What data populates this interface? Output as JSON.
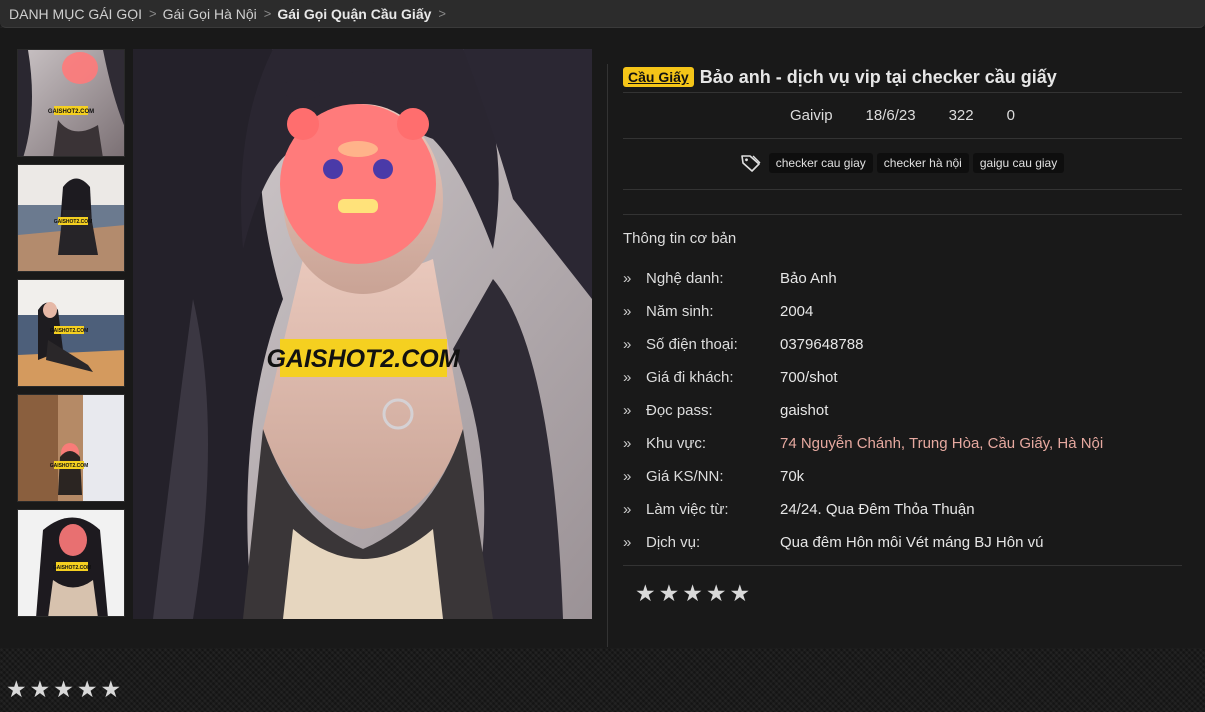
{
  "breadcrumb": {
    "items": [
      {
        "label": "DANH MỤC GÁI GỌI"
      },
      {
        "label": "Gái Gọi Hà Nội"
      },
      {
        "label": "Gái Gọi Quận Cầu Giấy"
      }
    ]
  },
  "watermark": "GAISHOT2.COM",
  "post": {
    "badge": "Cầu Giấy",
    "title": "Bảo anh - dịch vụ vip tại checker cầu giấy",
    "author": "Gaivip",
    "date": "18/6/23",
    "views": "322",
    "comments": "0",
    "tags": [
      "checker cau giay",
      "checker hà nội",
      "gaigu cau giay"
    ]
  },
  "details": {
    "section_title": "Thông tin cơ bản",
    "rows": [
      {
        "label": "Nghệ danh:",
        "value": "Bảo Anh"
      },
      {
        "label": "Năm sinh:",
        "value": "2004"
      },
      {
        "label": "Số điện thoại:",
        "value": "0379648788"
      },
      {
        "label": "Giá đi khách:",
        "value": "700/shot"
      },
      {
        "label": "Đọc pass:",
        "value": "gaishot"
      },
      {
        "label": "Khu vực:",
        "value": "74 Nguyễn Chánh, Trung Hòa, Cầu Giấy, Hà Nội"
      },
      {
        "label": "Giá KS/NN:",
        "value": "70k"
      },
      {
        "label": "Làm việc từ:",
        "value": "24/24. Qua Đêm Thỏa Thuận"
      },
      {
        "label": "Dịch vụ:",
        "value": "Qua đêm Hôn môi Vét máng BJ Hôn vú"
      }
    ]
  },
  "rating": {
    "stars_shown": 5,
    "filled": 0
  },
  "colors": {
    "badge": "#f5c518",
    "link": "#e6a9a0",
    "background": "#191919"
  }
}
